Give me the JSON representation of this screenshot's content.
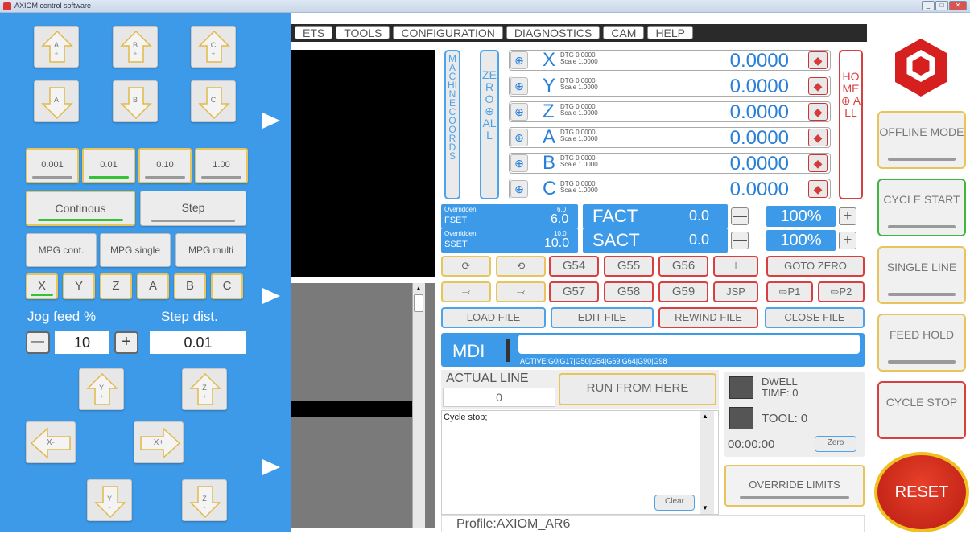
{
  "window": {
    "title": "AXIOM control software",
    "close": "✕",
    "min": "_",
    "max": "□"
  },
  "jog": {
    "top_up": [
      {
        "label": "A",
        "sign": "+"
      },
      {
        "label": "B",
        "sign": "+"
      },
      {
        "label": "C",
        "sign": "+"
      }
    ],
    "top_down": [
      {
        "label": "A",
        "sign": "-"
      },
      {
        "label": "B",
        "sign": "-"
      },
      {
        "label": "C",
        "sign": "-"
      }
    ],
    "increments": [
      "0.001",
      "0.01",
      "0.10",
      "1.00"
    ],
    "increment_selected": 1,
    "mode_continuous": "Continous",
    "mode_step": "Step",
    "mpg": [
      "MPG cont.",
      "MPG single",
      "MPG multi"
    ],
    "axes": [
      "X",
      "Y",
      "Z",
      "A",
      "B",
      "C"
    ],
    "jog_feed_label": "Jog feed %",
    "step_dist_label": "Step dist.",
    "jog_feed_value": "10",
    "step_dist_value": "0.01",
    "minus": "—",
    "plus": "+",
    "y_plus": {
      "label": "Y",
      "sign": "+"
    },
    "z_plus": {
      "label": "Z",
      "sign": "+"
    },
    "x_minus": "X-",
    "x_plus": "X+",
    "y_minus": {
      "label": "Y",
      "sign": "-"
    },
    "z_minus": {
      "label": "Z",
      "sign": "-"
    }
  },
  "menu": [
    "ETS",
    "TOOLS",
    "CONFIGURATION",
    "DIAGNOSTICS",
    "CAM",
    "HELP"
  ],
  "dro": {
    "machine_coords": "MACHINE COORDS",
    "zero_all": "ZERO ⊕ ALL",
    "home_all": "HOME ⊕ ALL",
    "axes": [
      {
        "letter": "X",
        "dtg": "DTG  0.0000",
        "scale": "Scale 1.0000",
        "value": "0.0000"
      },
      {
        "letter": "Y",
        "dtg": "DTG  0.0000",
        "scale": "Scale 1.0000",
        "value": "0.0000"
      },
      {
        "letter": "Z",
        "dtg": "DTG  0.0000",
        "scale": "Scale 1.0000",
        "value": "0.0000"
      },
      {
        "letter": "A",
        "dtg": "DTG  0.0000",
        "scale": "Scale 1.0000",
        "value": "0.0000"
      },
      {
        "letter": "B",
        "dtg": "DTG  0.0000",
        "scale": "Scale 1.0000",
        "value": "0.0000"
      },
      {
        "letter": "C",
        "dtg": "DTG  0.0000",
        "scale": "Scale 1.0000",
        "value": "0.0000"
      }
    ]
  },
  "feed": {
    "overridden": "Overridden",
    "fset_label": "FSET",
    "fset_top": "6.0",
    "fset_val": "6.0",
    "fact_label": "FACT",
    "fact_val": "0.0",
    "pct": "100%"
  },
  "spindle": {
    "overridden": "Overridden",
    "sset_label": "SSET",
    "sset_top": "10.0",
    "sset_val": "10.0",
    "sact_label": "SACT",
    "sact_val": "0.0",
    "pct": "100%"
  },
  "wcs": {
    "row1": [
      "G54",
      "G55",
      "G56"
    ],
    "row2": [
      "G57",
      "G58",
      "G59"
    ],
    "goto_zero": "GOTO ZERO",
    "jsp": "JSP",
    "p1": "⇨P1",
    "p2": "⇨P2"
  },
  "file": {
    "load": "LOAD FILE",
    "edit": "EDIT FILE",
    "rewind": "REWIND FILE",
    "close": "CLOSE FILE"
  },
  "mdi": {
    "label": "MDI",
    "active": "ACTIVE:G0|G17|G50|G54|G69|G64|G90|G98",
    "input": ""
  },
  "line": {
    "actual_label": "ACTUAL LINE",
    "actual_value": "0",
    "run_from_here": "RUN FROM HERE"
  },
  "status": {
    "dwell": "DWELL TIME: 0",
    "tool": "TOOL:  0",
    "time": "00:00:00",
    "zero": "Zero",
    "override": "OVERRIDE LIMITS"
  },
  "console": {
    "text": "Cycle stop;",
    "clear": "Clear",
    "profile": "Profile:AXIOM_AR6"
  },
  "right": {
    "offline": "OFFLINE MODE",
    "cycle_start": "CYCLE START",
    "single_line": "SINGLE LINE",
    "feed_hold": "FEED HOLD",
    "cycle_stop": "CYCLE STOP",
    "reset": "RESET"
  },
  "colors": {
    "panel_blue": "#3d9ae8",
    "accent_blue": "#2a80d8",
    "red": "#d83a3a",
    "gold": "#e7c55a",
    "green": "#35c335"
  }
}
